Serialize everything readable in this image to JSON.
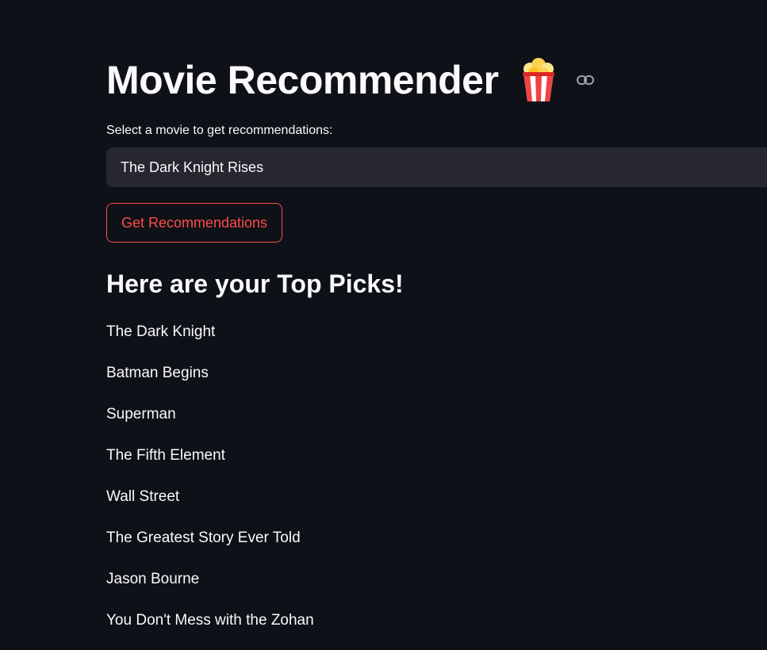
{
  "header": {
    "title": "Movie Recommender",
    "emoji": "popcorn-icon"
  },
  "select": {
    "label": "Select a movie to get recommendations:",
    "value": "The Dark Knight Rises"
  },
  "button": {
    "label": "Get Recommendations"
  },
  "results": {
    "heading": "Here are your Top Picks!",
    "items": [
      "The Dark Knight",
      "Batman Begins",
      "Superman",
      "The Fifth Element",
      "Wall Street",
      "The Greatest Story Ever Told",
      "Jason Bourne",
      "You Don't Mess with the Zohan"
    ]
  },
  "colors": {
    "background": "#0e1117",
    "text": "#fafafa",
    "input_bg": "#262730",
    "accent": "#ff4b4b"
  }
}
